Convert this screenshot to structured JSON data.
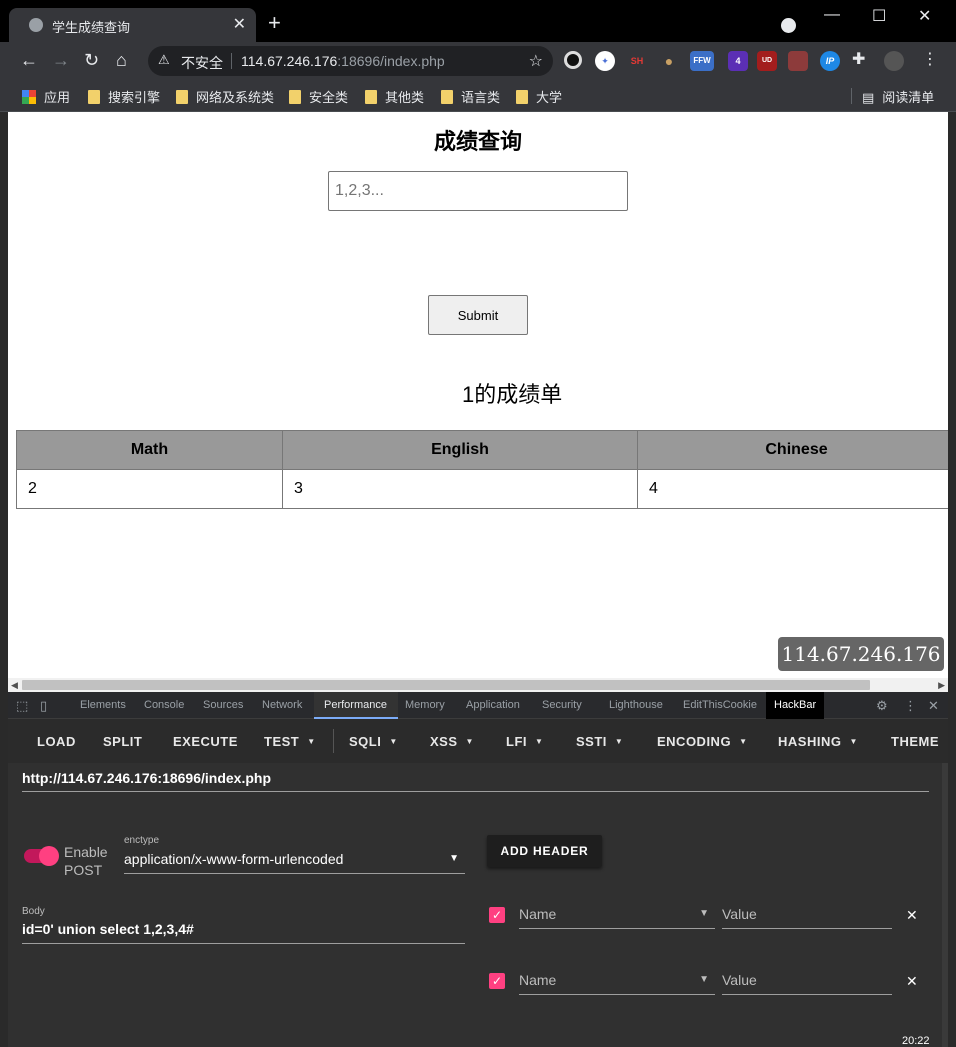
{
  "browser": {
    "tab_title": "学生成绩查询",
    "tab_close": "✕",
    "new_tab": "+",
    "window_controls": {
      "minimize": "—",
      "maximize": "☐",
      "close": "✕"
    },
    "omnibox": {
      "security_label": "不安全",
      "url_host": "114.67.246.176",
      "url_rest": ":18696/index.php"
    },
    "extensions": [
      {
        "name": "sh-extension",
        "label": "SH",
        "color": "#cc2b2b"
      },
      {
        "name": "ffw-extension",
        "label": "FFW",
        "color": "#3b6fc7"
      },
      {
        "name": "badge-extension",
        "label": "4",
        "color": "#5b2fb5"
      },
      {
        "name": "ublock-extension",
        "label": "UD",
        "color": "#a31d1d"
      },
      {
        "name": "ip-extension",
        "label": "IP",
        "color": "#1e88e5"
      }
    ]
  },
  "bookmarks": {
    "apps": "应用",
    "folders": [
      "搜索引擎",
      "网络及系统类",
      "安全类",
      "其他类",
      "语言类",
      "大学"
    ],
    "reading_list": "阅读清单"
  },
  "page": {
    "title": "成绩查询",
    "input_placeholder": "1,2,3...",
    "submit_label": "Submit",
    "result_heading": "1的成绩单",
    "table": {
      "headers": [
        "Math",
        "English",
        "Chinese"
      ],
      "rows": [
        [
          "2",
          "3",
          "4"
        ]
      ]
    },
    "ip_badge": "114.67.246.176"
  },
  "devtools": {
    "tabs": [
      "Elements",
      "Console",
      "Sources",
      "Network",
      "Performance",
      "Memory",
      "Application",
      "Security",
      "Lighthouse",
      "EditThisCookie",
      "HackBar"
    ],
    "active_tab": "Performance"
  },
  "hackbar": {
    "menu": {
      "load": "LOAD",
      "split": "SPLIT",
      "execute": "EXECUTE",
      "test": "TEST",
      "sqli": "SQLI",
      "xss": "XSS",
      "lfi": "LFI",
      "ssti": "SSTI",
      "encoding": "ENCODING",
      "hashing": "HASHING",
      "theme": "THEME"
    },
    "url_value": "http://114.67.246.176:18696/index.php",
    "enable_post_label_1": "Enable",
    "enable_post_label_2": "POST",
    "enable_post": true,
    "enctype_label": "enctype",
    "enctype_value": "application/x-www-form-urlencoded",
    "add_header_label": "ADD HEADER",
    "body_label": "Body",
    "body_value": "id=0' union select 1,2,3,4#",
    "headers": [
      {
        "checked": true,
        "name_placeholder": "Name",
        "value_placeholder": "Value"
      },
      {
        "checked": true,
        "name_placeholder": "Name",
        "value_placeholder": "Value"
      }
    ]
  },
  "taskbar": {
    "clock": "20:22"
  },
  "colors": {
    "accent_pink": "#ff4081",
    "devtools_bg": "#303030",
    "table_header": "#999999"
  }
}
